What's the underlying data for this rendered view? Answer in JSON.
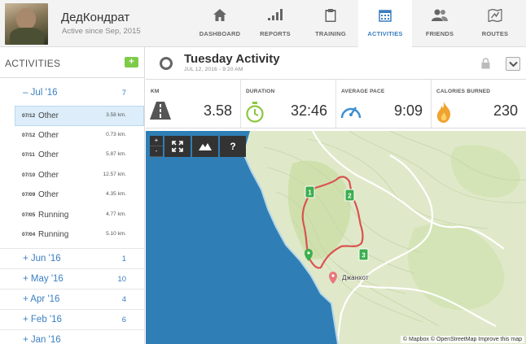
{
  "user": {
    "name": "ДедКондрат",
    "since": "Active since Sep, 2015"
  },
  "nav": [
    {
      "label": "DASHBOARD",
      "icon": "home-icon"
    },
    {
      "label": "REPORTS",
      "icon": "bar-chart-icon"
    },
    {
      "label": "TRAINING",
      "icon": "clipboard-icon"
    },
    {
      "label": "ACTIVITIES",
      "icon": "calendar-icon",
      "active": true
    },
    {
      "label": "FRIENDS",
      "icon": "friends-icon"
    },
    {
      "label": "ROUTES",
      "icon": "route-map-icon"
    }
  ],
  "sidebar": {
    "title": "ACTIVITIES",
    "add_label": "+",
    "open_month": {
      "toggle": "–",
      "label": "Jul '16",
      "count": "7"
    },
    "activities": [
      {
        "date": "07/12",
        "type": "Other",
        "distance": "3.58 km.",
        "selected": true
      },
      {
        "date": "07/12",
        "type": "Other",
        "distance": "0.73 km."
      },
      {
        "date": "07/11",
        "type": "Other",
        "distance": "5.87 km."
      },
      {
        "date": "07/10",
        "type": "Other",
        "distance": "12.57 km."
      },
      {
        "date": "07/09",
        "type": "Other",
        "distance": "4.35 km."
      },
      {
        "date": "07/05",
        "type": "Running",
        "distance": "4.77 km."
      },
      {
        "date": "07/04",
        "type": "Running",
        "distance": "5.10 km."
      }
    ],
    "months": [
      {
        "label": "+ Jun '16",
        "count": "1"
      },
      {
        "label": "+ May '16",
        "count": "10"
      },
      {
        "label": "+ Apr '16",
        "count": "4"
      },
      {
        "label": "+ Feb '16",
        "count": "6"
      },
      {
        "label": "+ Jan '16",
        "count": ""
      }
    ]
  },
  "activity": {
    "title": "Tuesday Activity",
    "subtitle": "JUL 12, 2016  -  9:20 AM"
  },
  "stats": [
    {
      "label": "KM",
      "value": "3.58",
      "icon": "road-icon"
    },
    {
      "label": "DURATION",
      "value": "32:46",
      "icon": "stopwatch-icon"
    },
    {
      "label": "AVERAGE PACE",
      "value": "9:09",
      "icon": "speedometer-icon"
    },
    {
      "label": "CALORIES BURNED",
      "value": "230",
      "icon": "flame-icon"
    }
  ],
  "map": {
    "zoom_in": "+",
    "zoom_out": "-",
    "help_label": "?",
    "place_label": "Джанхот",
    "attribution": "© Mapbox © OpenStreetMap Improve this map",
    "markers": [
      "1",
      "2",
      "3"
    ],
    "colors": {
      "route": "#d9534f",
      "land": "#dfe9c9",
      "sea": "#2f7fb6",
      "marker": "#3cae4e"
    }
  }
}
